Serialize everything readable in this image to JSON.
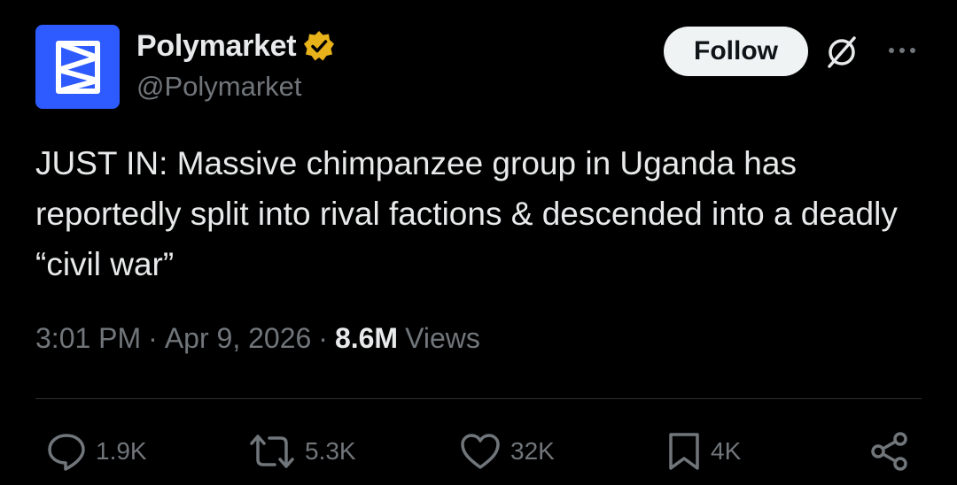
{
  "author": {
    "display_name": "Polymarket",
    "handle": "@Polymarket",
    "verified": true,
    "avatar_color": "#2e5bff",
    "badge_color": "#e8b21a"
  },
  "header_actions": {
    "follow_label": "Follow",
    "grok_icon": "grok-icon",
    "more_icon": "more-horizontal-icon"
  },
  "tweet": {
    "text": "JUST IN: Massive chimpanzee group in Uganda has reportedly split into rival factions & descended into a deadly “civil war”",
    "time": "3:01 PM",
    "date": "Apr 9, 2026",
    "views_count": "8.6M",
    "views_label": "Views",
    "separator": "·"
  },
  "engagement": {
    "replies": "1.9K",
    "reposts": "5.3K",
    "likes": "32K",
    "bookmarks": "4K"
  },
  "colors": {
    "background": "#000000",
    "text_primary": "#e7e9ea",
    "text_secondary": "#71767b",
    "divider": "#2f3336",
    "follow_bg": "#eff3f4"
  }
}
